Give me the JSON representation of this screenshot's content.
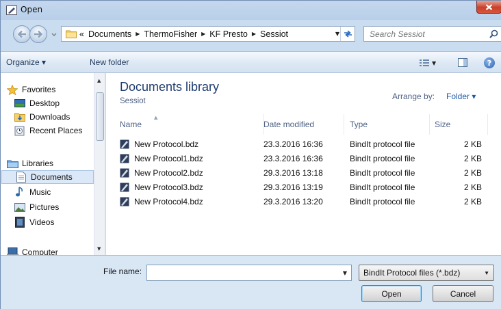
{
  "window": {
    "title": "Open"
  },
  "address": {
    "overflow": "«",
    "crumbs": [
      "Documents",
      "ThermoFisher",
      "KF Presto",
      "Sessiot"
    ]
  },
  "search": {
    "placeholder": "Search Sessiot"
  },
  "toolbar": {
    "organize": "Organize ▾",
    "new_folder": "New folder"
  },
  "navigation": {
    "favorites": "Favorites",
    "desktop": "Desktop",
    "downloads": "Downloads",
    "recent_places": "Recent Places",
    "libraries": "Libraries",
    "documents": "Documents",
    "music": "Music",
    "pictures": "Pictures",
    "videos": "Videos",
    "computer": "Computer"
  },
  "library": {
    "title": "Documents library",
    "subtitle": "Sessiot",
    "arrange_label": "Arrange by:",
    "arrange_value": "Folder ▾"
  },
  "columns": {
    "name": "Name",
    "date": "Date modified",
    "type": "Type",
    "size": "Size"
  },
  "files": [
    {
      "name": "New Protocol.bdz",
      "date": "23.3.2016 16:36",
      "type": "BindIt protocol file",
      "size": "2 KB"
    },
    {
      "name": "New Protocol1.bdz",
      "date": "23.3.2016 16:36",
      "type": "BindIt protocol file",
      "size": "2 KB"
    },
    {
      "name": "New Protocol2.bdz",
      "date": "29.3.2016 13:18",
      "type": "BindIt protocol file",
      "size": "2 KB"
    },
    {
      "name": "New Protocol3.bdz",
      "date": "29.3.2016 13:19",
      "type": "BindIt protocol file",
      "size": "2 KB"
    },
    {
      "name": "New Protocol4.bdz",
      "date": "29.3.2016 13:20",
      "type": "BindIt protocol file",
      "size": "2 KB"
    }
  ],
  "footer": {
    "file_name_label": "File name:",
    "file_name_value": "",
    "file_type": "BindIt Protocol files (*.bdz)",
    "open": "Open",
    "cancel": "Cancel"
  },
  "icons": {
    "window": "app-icon",
    "back": "back-arrow-icon",
    "forward": "forward-arrow-icon",
    "refresh": "refresh-icon",
    "search": "search-icon",
    "views": "views-icon",
    "preview": "preview-pane-icon",
    "help": "help-icon",
    "file": "bdz-file-icon"
  }
}
